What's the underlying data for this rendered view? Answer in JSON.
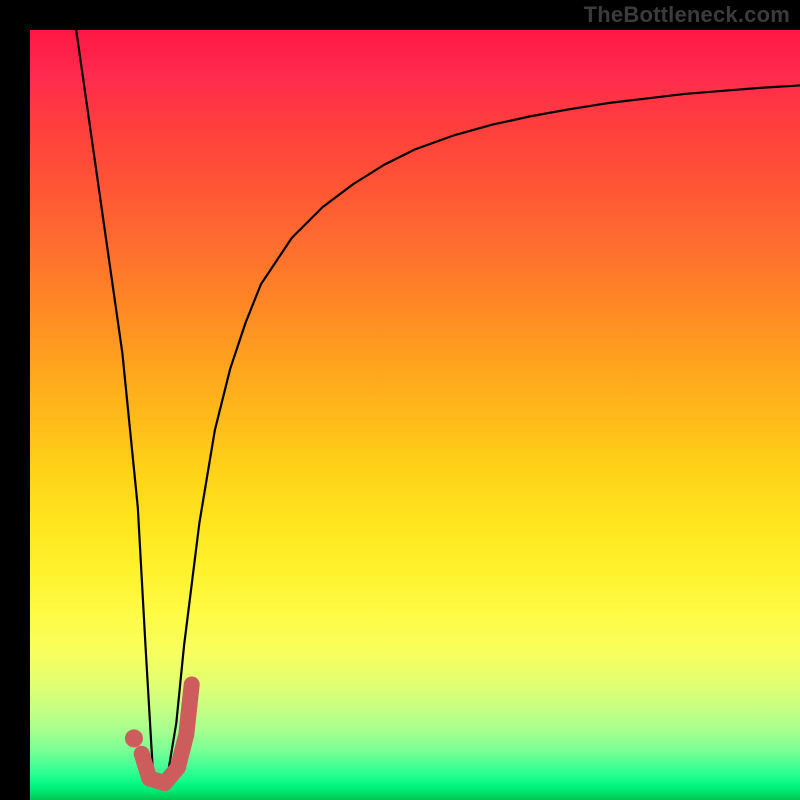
{
  "watermark": "TheBottleneck.com",
  "colors": {
    "frame_bg": "#000000",
    "curve": "#000000",
    "marker": "#cd5c5c",
    "gradient_top": "#ff1744",
    "gradient_bottom": "#00c650"
  },
  "chart_data": {
    "type": "line",
    "title": "",
    "xlabel": "",
    "ylabel": "",
    "xlim": [
      0,
      100
    ],
    "ylim": [
      0,
      100
    ],
    "notes": "Bottleneck-style V-curve on vertical heat gradient. Minimum (optimal point) near x≈16. Marker highlights the region around the minimum.",
    "series": [
      {
        "name": "bottleneck-curve",
        "x": [
          6,
          8,
          10,
          12,
          14,
          15,
          16,
          17,
          18,
          19,
          20,
          22,
          24,
          26,
          28,
          30,
          34,
          38,
          42,
          46,
          50,
          55,
          60,
          65,
          70,
          75,
          80,
          85,
          90,
          95,
          100
        ],
        "y": [
          100,
          86,
          72,
          58,
          38,
          20,
          3,
          2,
          4,
          10,
          20,
          36,
          48,
          56,
          62,
          67,
          73,
          77,
          80,
          82.5,
          84.5,
          86.3,
          87.7,
          88.8,
          89.7,
          90.5,
          91.1,
          91.7,
          92.1,
          92.5,
          92.8
        ]
      }
    ],
    "marker": {
      "dot": {
        "x": 13.5,
        "y": 8
      },
      "hook_path": [
        {
          "x": 14.5,
          "y": 6
        },
        {
          "x": 15.5,
          "y": 2.8
        },
        {
          "x": 17.5,
          "y": 2.2
        },
        {
          "x": 19.2,
          "y": 4.2
        },
        {
          "x": 20.3,
          "y": 8.5
        },
        {
          "x": 21.0,
          "y": 15.0
        }
      ]
    }
  }
}
